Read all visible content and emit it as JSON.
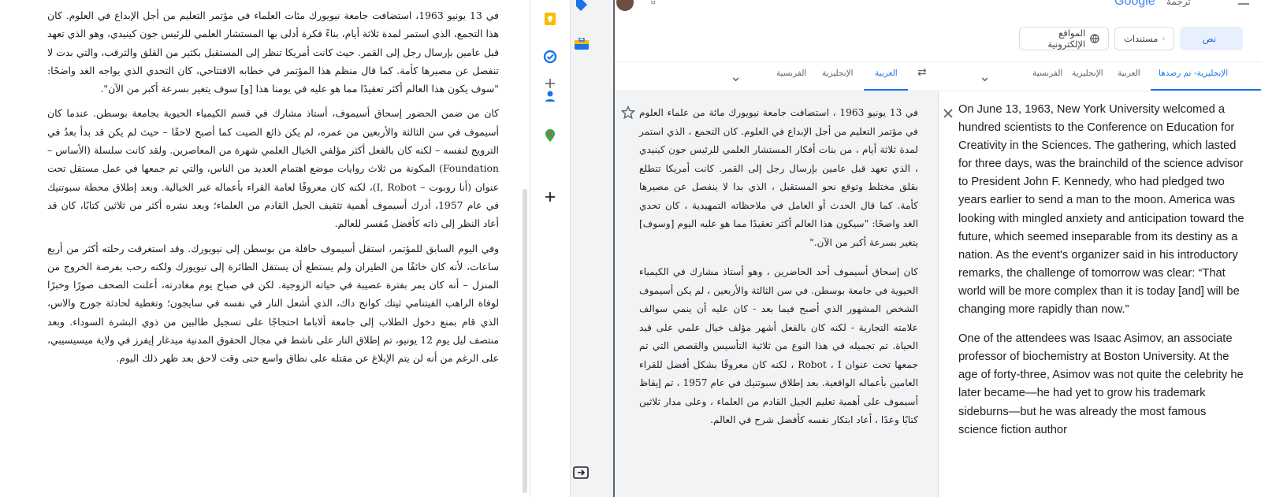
{
  "document": {
    "paragraphs": [
      "في 13 يونيو 1963، استضافت جامعة نيويورك مئات العلماء في مؤتمر التعليم من أجل الإبداع في العلوم. كان هذا التجمع، الذي استمر لمدة ثلاثة أيام، بناءً فكرة أدلى بها المستشار العلمي للرئيس جون كينيدي، وهو الذي تعهد قبل عامين بإرسال رجل إلى القمر. حيث كانت أمريكا تنظر إلى المستقبل بكثير من القلق والترقب، والتي بدت لا تنفصل عن مصيرها كأمة. كما قال منظم هذا المؤتمر في خطابه الافتتاحي، كان التحدي الذي يواجه الغد واضحًا: \"سوف يكون هذا العالم أكثر تعقيدًا مما هو عليه في يومنا هذا [و] سوف يتغير بسرعة أكبر من الآن\".",
      "كان من ضمن الحضور إسحاق أسيموف، أستاذ مشارك في قسم الكيمياء الحيوية بجامعة بوسطن. عندما كان أسيموف في سن الثالثة والأربعين من عمره، لم يكن ذائع الصيت كما أصبح لاحقًا – حيث لم يكن قد بدأ بعدُ في الترويج لنفسه – لكنه كان بالفعل أكثر مؤلفي الخيال العلمي شهرة من المعاصرين. ولقد كانت سلسلة (الأساس – Foundation) المكونة من ثلاث روايات موضع اهتمام العديد من الناس، والتي تم جمعها في عمل مستقل تحت عنوان (أنا روبوت – I, Robot)، لكنه كان معروفًا لعامة القراء بأعماله غير الخيالية. وبعد إطلاق محطة سبوتنيك في عام 1957، أدرك أسيموف أهمية تثقيف الجيل القادم من العلماء؛ وبعد نشره أكثر من ثلاثين كتابًا، كان قد أعاد النظر إلى ذاته كأفضل مُفسر للعالم.",
      "وفي اليوم السابق للمؤتمر، استقل أسيموف حافلة من بوسطن إلى نيويورك. وقد استغرقت رحلته أكثر من أربع ساعات، لأنه كان خائفًا من الطيران ولم يستطع أن يستقل الطائرة إلى نيويورك ولكنه رحب بفرصة الخروج من المنزل – أنه كان يمر بفترة عصيبة في حياته الزوجية. لكن في صباح يوم مغادرته، أعلنت الصحف صورًا وخبرًا لوفاة الراهب الفيتنامي ثيتك كوانج داك، الذي أشعل النار في نفسه في سايجون؛ وتغطية لحادثة جورج والاس، الذي قام بمنع دخول الطلاب إلى جامعة ألاباما احتجاجًا على تسجيل طالبين من ذوي البشرة السوداء. وبعد منتصف ليل يوم 12 يونيو، تم إطلاق النار على ناشط في مجال الحقوق المدنية ميدغار إيفرز في ولاية ميسيسيبي، على الرغم من أنه لن يتم الإبلاغ عن مقتله على نطاق واسع حتى وقت لاحق بعد ظهر ذلك اليوم."
    ]
  },
  "sidebar": {
    "icons": [
      "keep-icon",
      "tasks-icon",
      "add-icon",
      "contacts-icon",
      "maps-icon",
      "add-icon",
      "hide-panel-icon"
    ]
  },
  "translate": {
    "brand": "Google",
    "brand_prefix": "ترجمة",
    "types": [
      {
        "label": "نص",
        "icon": "translate-icon",
        "active": true
      },
      {
        "label": "مستندات",
        "icon": "document-icon",
        "active": false
      },
      {
        "label": "المواقع الإلكترونية",
        "icon": "globe-icon",
        "active": false
      }
    ],
    "source_langs": [
      "الإنجليزية- تم رصدها",
      "العربية",
      "الإنجليزية",
      "الفرنسية"
    ],
    "target_langs": [
      "العربية",
      "الإنجليزية",
      "الفرنسية"
    ],
    "source_paragraphs": [
      "في 13 يونيو 1963 ، استضافت جامعة نيويورك مائة من علماء العلوم في مؤتمر التعليم من أجل الإبداع في العلوم. كان التجمع ، الذي استمر لمدة ثلاثة أيام ، من بنات أفكار المستشار العلمي للرئيس جون كينيدي ، الذي تعهد قبل عامين بإرسال رجل إلى القمر. كانت أمريكا تتطلع بقلق مختلط وتوقع نحو المستقبل ، الذي بدا لا ينفصل عن مصيرها كأمة. كما قال الحدث أو العامل في ملاحظاته التمهيدية ، كان تحدي الغد واضحًا: \"سيكون هذا العالم أكثر تعقيدًا مما هو عليه اليوم [وسوف] يتغير بسرعة أكبر من الآن.\"",
      "كان إسحاق أسيموف أحد الحاضرين ، وهو أستاذ مشارك في الكيمياء الحيوية في جامعة بوسطن. في سن الثالثة والأربعين ، لم يكن أسيموف الشخص المشهور الذي أصبح فيما بعد - كان عليه أن ينمي سوالف علامته التجارية - لكنه كان بالفعل أشهر مؤلف خيال علمي على قيد الحياة. تم تجميله في هذا النوع من ثلاثية التأسيس والقصص التي تم جمعها تحت عنوان Robot ، I ، لكنه كان معروفًا بشكل أفضل للقراء العامين بأعماله الواقعية. بعد إطلاق سبوتنيك في عام 1957 ، تم إيقاظ أسيموف على أهمية تعليم الجيل القادم من العلماء ، وعلى مدار ثلاثين كتابًا وعدًا ، أعاد ابتكار نفسه كأفضل شرح في العالم."
    ],
    "target_paragraphs": [
      "On June 13, 1963, New York University welcomed a hundred scien⁠tists to the Conference on Education for Creativity in the Sciences. The gathering, which lasted for three days, was the brainchild of the science advisor to President John F. Kennedy, who had pledged two years earlier to send a man to the moon. America was looking with mingled anxiety and anticipation toward the future, which seemed inseparable from its destiny as a nation. As the event's or⁠ganizer said in his introductory remarks, the challenge of tomorrow was clear: “That world will be more complex than it is today [and] will be changing more rapidly than now.”",
      "One of the attendees was Isaac Asimov, an associate professor of biochemistry at Boston University. At the age of forty-three, Asimov was not quite the celebrity he later became—he had yet to grow his trademark sideburns—but he was already the most famous science fiction author"
    ]
  },
  "colors": {
    "accent": "#1a73e8",
    "underline": "#d50000"
  }
}
